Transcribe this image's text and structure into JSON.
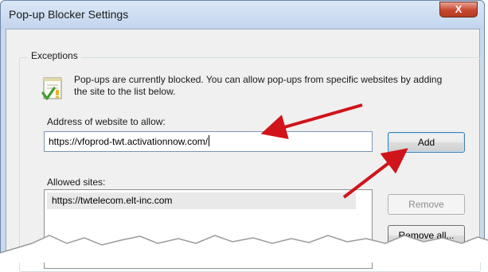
{
  "window": {
    "title": "Pop-up Blocker Settings",
    "close_glyph": "X"
  },
  "exceptions": {
    "group_label": "Exceptions",
    "icon": "popup-blocked-checkmark-icon",
    "info_text": "Pop-ups are currently blocked.  You can allow pop-ups from specific websites by adding the site to the list below."
  },
  "address": {
    "label": "Address of website to allow:",
    "value": "https://vfoprod-twt.activationnow.com/"
  },
  "buttons": {
    "add": "Add",
    "remove": "Remove",
    "remove_all": "Remove all..."
  },
  "allowed": {
    "label": "Allowed sites:",
    "sites": [
      "https://twtelecom.elt-inc.com"
    ]
  },
  "colors": {
    "annotation_arrow": "#d0141a",
    "title_bar": "#c9d9ee",
    "close_button": "#c6472f"
  }
}
